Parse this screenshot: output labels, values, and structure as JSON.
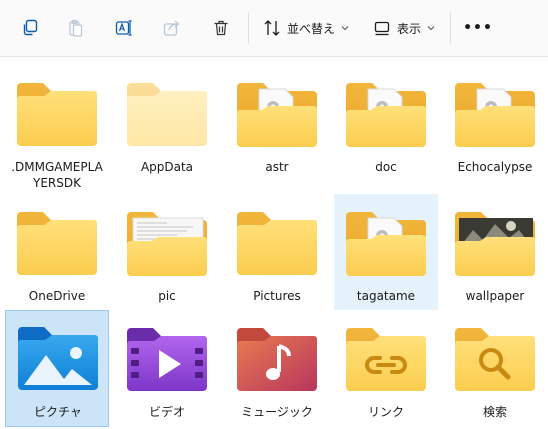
{
  "toolbar": {
    "sort_label": "並べ替え",
    "view_label": "表示",
    "more_label": "•••"
  },
  "items": [
    {
      "label": ".DMMGAMEPLAYERSDK",
      "label_line1": ".DMMGAMEPLA",
      "label_line2": "YERSDK",
      "icon": "folder-icon"
    },
    {
      "label": "AppData",
      "icon": "folder-hidden-icon"
    },
    {
      "label": "astr",
      "icon": "folder-with-file-icon"
    },
    {
      "label": "doc",
      "icon": "folder-with-file-icon"
    },
    {
      "label": "Echocalypse",
      "icon": "folder-with-file-icon"
    },
    {
      "label": "OneDrive",
      "icon": "folder-icon"
    },
    {
      "label": "pic",
      "icon": "folder-with-document-icon"
    },
    {
      "label": "Pictures",
      "icon": "folder-icon"
    },
    {
      "label": "tagatame",
      "icon": "folder-with-file-icon",
      "state": "hover"
    },
    {
      "label": "wallpaper",
      "icon": "folder-with-photo-icon"
    },
    {
      "label": "ピクチャ",
      "icon": "pictures-library-icon",
      "state": "selected"
    },
    {
      "label": "ビデオ",
      "icon": "videos-library-icon"
    },
    {
      "label": "ミュージック",
      "icon": "music-library-icon"
    },
    {
      "label": "リンク",
      "icon": "links-folder-icon"
    },
    {
      "label": "検索",
      "icon": "search-folder-icon"
    }
  ],
  "colors": {
    "folder_back": "#f0b53f",
    "folder_front": "#fcd867",
    "selection": "#cce4f7",
    "hover": "#e5f1fb",
    "accent": "#0067c0"
  }
}
